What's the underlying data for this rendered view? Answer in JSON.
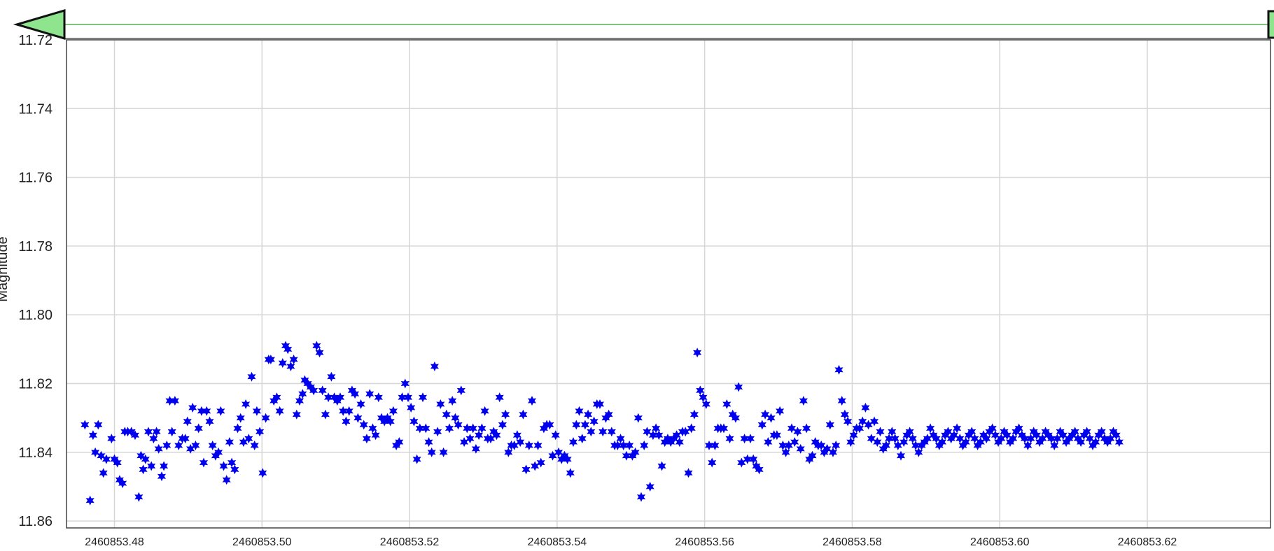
{
  "chart_data": {
    "type": "scatter",
    "title": "",
    "xlabel": "",
    "ylabel": "Magnitude",
    "xlim": [
      2460853.4735,
      2460853.6367
    ],
    "ylim": [
      11.72,
      11.862
    ],
    "y_inverted": true,
    "grid": true,
    "marker": "star",
    "color": "#0000ee",
    "x_ticks": [
      "2460853.48",
      "2460853.50",
      "2460853.52",
      "2460853.54",
      "2460853.56",
      "2460853.58",
      "2460853.60",
      "2460853.62"
    ],
    "y_ticks": [
      "11.72",
      "11.74",
      "11.76",
      "11.78",
      "11.80",
      "11.82",
      "11.84",
      "11.86"
    ],
    "x": [
      2460853.476,
      2460853.4767,
      2460853.4771,
      2460853.4774,
      2460853.4778,
      2460853.4782,
      2460853.4785,
      2460853.4789,
      2460853.4796,
      2460853.48,
      2460853.4804,
      2460853.4807,
      2460853.4811,
      2460853.4814,
      2460853.4818,
      2460853.4823,
      2460853.4828,
      2460853.4833,
      2460853.4836,
      2460853.4839,
      2460853.4842,
      2460853.4846,
      2460853.485,
      2460853.4853,
      2460853.4857,
      2460853.486,
      2460853.4864,
      2460853.4867,
      2460853.4871,
      2460853.4875,
      2460853.4878,
      2460853.4882,
      2460853.4887,
      2460853.4892,
      2460853.4896,
      2460853.4899,
      2460853.4903,
      2460853.4906,
      2460853.491,
      2460853.4914,
      2460853.4918,
      2460853.4921,
      2460853.4925,
      2460853.4929,
      2460853.4933,
      2460853.4937,
      2460853.4941,
      2460853.4944,
      2460853.4948,
      2460853.4952,
      2460853.4956,
      2460853.4959,
      2460853.4963,
      2460853.4967,
      2460853.4971,
      2460853.4975,
      2460853.4978,
      2460853.4982,
      2460853.4986,
      2460853.499,
      2460853.4993,
      2460853.4997,
      2460853.5001,
      2460853.5005,
      2460853.5009,
      2460853.5012,
      2460853.5016,
      2460853.502,
      2460853.5024,
      2460853.5028,
      2460853.5032,
      2460853.5035,
      2460853.5039,
      2460853.5043,
      2460853.5047,
      2460853.5051,
      2460853.5055,
      2460853.5058,
      2460853.5062,
      2460853.5066,
      2460853.507,
      2460853.5074,
      2460853.5078,
      2460853.5082,
      2460853.5086,
      2460853.509,
      2460853.5094,
      2460853.5098,
      2460853.5102,
      2460853.5106,
      2460853.511,
      2460853.5114,
      2460853.5118,
      2460853.5122,
      2460853.5126,
      2460853.513,
      2460853.5134,
      2460853.5138,
      2460853.5142,
      2460853.5146,
      2460853.515,
      2460853.5154,
      2460853.5158,
      2460853.5162,
      2460853.5166,
      2460853.517,
      2460853.5174,
      2460853.5178,
      2460853.5182,
      2460853.5186,
      2460853.519,
      2460853.5194,
      2460853.5198,
      2460853.5202,
      2460853.5206,
      2460853.521,
      2460853.5214,
      2460853.5218,
      2460853.5222,
      2460853.5226,
      2460853.523,
      2460853.5234,
      2460853.5238,
      2460853.5242,
      2460853.5246,
      2460853.525,
      2460853.5254,
      2460853.5258,
      2460853.5262,
      2460853.5266,
      2460853.527,
      2460853.5274,
      2460853.5278,
      2460853.5282,
      2460853.5286,
      2460853.529,
      2460853.5294,
      2460853.5298,
      2460853.5302,
      2460853.5306,
      2460853.531,
      2460853.5314,
      2460853.5318,
      2460853.5322,
      2460853.5326,
      2460853.533,
      2460853.5334,
      2460853.5338,
      2460853.5342,
      2460853.5346,
      2460853.535,
      2460853.5354,
      2460853.5358,
      2460853.5362,
      2460853.5366,
      2460853.537,
      2460853.5374,
      2460853.5378,
      2460853.5382,
      2460853.5386,
      2460853.539,
      2460853.5394,
      2460853.5398,
      2460853.5402,
      2460853.5406,
      2460853.541,
      2460853.5414,
      2460853.5418,
      2460853.5422,
      2460853.5426,
      2460853.543,
      2460853.5434,
      2460853.5438,
      2460853.5442,
      2460853.5446,
      2460853.545,
      2460853.5454,
      2460853.5458,
      2460853.5462,
      2460853.5466,
      2460853.547,
      2460853.5474,
      2460853.5478,
      2460853.5482,
      2460853.5486,
      2460853.549,
      2460853.5494,
      2460853.5498,
      2460853.5502,
      2460853.5506,
      2460853.551,
      2460853.5514,
      2460853.5518,
      2460853.5522,
      2460853.5526,
      2460853.553,
      2460853.5534,
      2460853.5538,
      2460853.5542,
      2460853.5546,
      2460853.555,
      2460853.5554,
      2460853.5558,
      2460853.5562,
      2460853.5566,
      2460853.557,
      2460853.5574,
      2460853.5578,
      2460853.5582,
      2460853.5586,
      2460853.559,
      2460853.5594,
      2460853.5598,
      2460853.5602,
      2460853.5606,
      2460853.561,
      2460853.5614,
      2460853.5618,
      2460853.5622,
      2460853.5626,
      2460853.563,
      2460853.5634,
      2460853.5638,
      2460853.5642,
      2460853.5646,
      2460853.565,
      2460853.5654,
      2460853.5658,
      2460853.5662,
      2460853.5666,
      2460853.567,
      2460853.5674,
      2460853.5678,
      2460853.5682,
      2460853.5686,
      2460853.569,
      2460853.5694,
      2460853.5698,
      2460853.5702,
      2460853.5706,
      2460853.571,
      2460853.5714,
      2460853.5718,
      2460853.5722,
      2460853.5726,
      2460853.573,
      2460853.5734,
      2460853.5738,
      2460853.5742,
      2460853.5746,
      2460853.575,
      2460853.5754,
      2460853.5758,
      2460853.5762,
      2460853.5766,
      2460853.577,
      2460853.5774,
      2460853.5778,
      2460853.5782,
      2460853.5786,
      2460853.579,
      2460853.5794,
      2460853.5798,
      2460853.5802,
      2460853.5806,
      2460853.581,
      2460853.5814,
      2460853.5818,
      2460853.5822,
      2460853.5826,
      2460853.583,
      2460853.5834,
      2460853.5838,
      2460853.5842,
      2460853.5846,
      2460853.585,
      2460853.5854,
      2460853.5858,
      2460853.5862,
      2460853.5866,
      2460853.587,
      2460853.5874,
      2460853.5878,
      2460853.5882,
      2460853.5886,
      2460853.589,
      2460853.5894,
      2460853.5898,
      2460853.5902,
      2460853.5906,
      2460853.591,
      2460853.5914,
      2460853.5918,
      2460853.5922,
      2460853.5926,
      2460853.593,
      2460853.5934,
      2460853.5938,
      2460853.5942,
      2460853.5946,
      2460853.595,
      2460853.5954,
      2460853.5958,
      2460853.5962,
      2460853.5966,
      2460853.597,
      2460853.5974,
      2460853.5978,
      2460853.5982,
      2460853.5986,
      2460853.599,
      2460853.5994,
      2460853.5998,
      2460853.6002,
      2460853.6006,
      2460853.601,
      2460853.6014,
      2460853.6018,
      2460853.6022,
      2460853.6026,
      2460853.603,
      2460853.6034,
      2460853.6038,
      2460853.6042,
      2460853.6046,
      2460853.605,
      2460853.6054,
      2460853.6058,
      2460853.6062,
      2460853.6066,
      2460853.607,
      2460853.6074,
      2460853.6078,
      2460853.6082,
      2460853.6086,
      2460853.609,
      2460853.6094,
      2460853.6098,
      2460853.6102,
      2460853.6106,
      2460853.611,
      2460853.6114,
      2460853.6118,
      2460853.6122,
      2460853.6126,
      2460853.613,
      2460853.6134,
      2460853.6138,
      2460853.6142,
      2460853.6146,
      2460853.615,
      2460853.6154,
      2460853.6158,
      2460853.6162,
      2460853.6166,
      2460853.617,
      2460853.6174,
      2460853.6178,
      2460853.6182,
      2460853.6186,
      2460853.619,
      2460853.6194,
      2460853.6198,
      2460853.6202,
      2460853.6206,
      2460853.621,
      2460853.6214,
      2460853.6218,
      2460853.6222,
      2460853.6226,
      2460853.623,
      2460853.6234,
      2460853.6238,
      2460853.6242,
      2460853.6246,
      2460853.625,
      2460853.6254,
      2460853.6258,
      2460853.6262,
      2460853.6266,
      2460853.627,
      2460853.6274,
      2460853.6278,
      2460853.6282,
      2460853.6286,
      2460853.629,
      2460853.6294,
      2460853.6298,
      2460853.6302,
      2460853.6306,
      2460853.631,
      2460853.6314,
      2460853.6318,
      2460853.6322,
      2460853.6326,
      2460853.633,
      2460853.6334,
      2460853.6338,
      2460853.6342
    ],
    "y": [
      11.832,
      11.854,
      11.835,
      11.84,
      11.832,
      11.841,
      11.846,
      11.842,
      11.836,
      11.842,
      11.843,
      11.848,
      11.849,
      11.834,
      11.834,
      11.834,
      11.835,
      11.853,
      11.841,
      11.845,
      11.842,
      11.834,
      11.844,
      11.836,
      11.834,
      11.839,
      11.847,
      11.844,
      11.838,
      11.825,
      11.834,
      11.825,
      11.838,
      11.836,
      11.836,
      11.831,
      11.839,
      11.827,
      11.838,
      11.833,
      11.828,
      11.843,
      11.828,
      11.831,
      11.838,
      11.841,
      11.84,
      11.828,
      11.844,
      11.848,
      11.837,
      11.843,
      11.845,
      11.833,
      11.83,
      11.837,
      11.826,
      11.836,
      11.818,
      11.838,
      11.828,
      11.834,
      11.846,
      11.83,
      11.813,
      11.813,
      11.825,
      11.824,
      11.828,
      11.814,
      11.809,
      11.81,
      11.815,
      11.813,
      11.829,
      11.825,
      11.823,
      11.819,
      11.82,
      11.821,
      11.822,
      11.809,
      11.811,
      11.822,
      11.829,
      11.824,
      11.818,
      11.824,
      11.825,
      11.824,
      11.828,
      11.831,
      11.828,
      11.822,
      11.823,
      11.83,
      11.826,
      11.832,
      11.836,
      11.823,
      11.833,
      11.835,
      11.824,
      11.83,
      11.831,
      11.83,
      11.831,
      11.828,
      11.838,
      11.837,
      11.824,
      11.82,
      11.824,
      11.827,
      11.831,
      11.842,
      11.833,
      11.824,
      11.833,
      11.837,
      11.84,
      11.815,
      11.834,
      11.826,
      11.84,
      11.829,
      11.833,
      11.825,
      11.83,
      11.832,
      11.822,
      11.837,
      11.833,
      11.836,
      11.833,
      11.839,
      11.835,
      11.833,
      11.828,
      11.836,
      11.836,
      11.834,
      11.835,
      11.824,
      11.832,
      11.829,
      11.84,
      11.838,
      11.838,
      11.835,
      11.837,
      11.829,
      11.845,
      11.838,
      11.825,
      11.844,
      11.838,
      11.843,
      11.833,
      11.832,
      11.832,
      11.841,
      11.835,
      11.84,
      11.842,
      11.841,
      11.842,
      11.846,
      11.837,
      11.832,
      11.828,
      11.836,
      11.832,
      11.829,
      11.834,
      11.831,
      11.826,
      11.826,
      11.834,
      11.83,
      11.829,
      11.834,
      11.838,
      11.838,
      11.836,
      11.838,
      11.841,
      11.838,
      11.841,
      11.84,
      11.83,
      11.853,
      11.838,
      11.834,
      11.85,
      11.835,
      11.833,
      11.835,
      11.844,
      11.837,
      11.836,
      11.837,
      11.836,
      11.835,
      11.837,
      11.834,
      11.834,
      11.846,
      11.833,
      11.829,
      11.811,
      11.822,
      11.824,
      11.826,
      11.838,
      11.843,
      11.838,
      11.833,
      11.833,
      11.833,
      11.826,
      11.836,
      11.829,
      11.83,
      11.821,
      11.843,
      11.836,
      11.842,
      11.836,
      11.842,
      11.844,
      11.845,
      11.832,
      11.829,
      11.837,
      11.83,
      11.835,
      11.835,
      11.828,
      11.838,
      11.84,
      11.838,
      11.833,
      11.837,
      11.834,
      11.839,
      11.825,
      11.833,
      11.842,
      11.841,
      11.837,
      11.838,
      11.838,
      11.84,
      11.839,
      11.832,
      11.84,
      11.838,
      11.816,
      11.825,
      11.829,
      11.831,
      11.837,
      11.835,
      11.833,
      11.833,
      11.831,
      11.827,
      11.832,
      11.836,
      11.831,
      11.837,
      11.834,
      11.839,
      11.838,
      11.836,
      11.834,
      11.836,
      11.838,
      11.841,
      11.837,
      11.835,
      11.834,
      11.836,
      11.838,
      11.84,
      11.838,
      11.837,
      11.836,
      11.833,
      11.835,
      11.836,
      11.838,
      11.837,
      11.835,
      11.834,
      11.836,
      11.835,
      11.833,
      11.836,
      11.838,
      11.837,
      11.835,
      11.834,
      11.836,
      11.838,
      11.837,
      11.835,
      11.836,
      11.834,
      11.833,
      11.835,
      11.837,
      11.836,
      11.834,
      11.835,
      11.837,
      11.836,
      11.834,
      11.833,
      11.835,
      11.836,
      11.838,
      11.836,
      11.834,
      11.835,
      11.837,
      11.836,
      11.834,
      11.835,
      11.836,
      11.838,
      11.836,
      11.834,
      11.835,
      11.837,
      11.836,
      11.835,
      11.834,
      11.836,
      11.837,
      11.835,
      11.834,
      11.836,
      11.838,
      11.837,
      11.835,
      11.834,
      11.836,
      11.837,
      11.836,
      11.834,
      11.835,
      11.837
    ]
  }
}
